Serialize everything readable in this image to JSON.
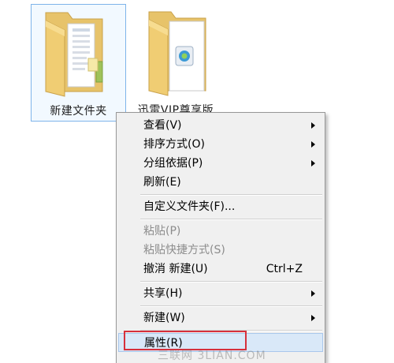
{
  "desktop": {
    "items": [
      {
        "label": "新建文件夹",
        "selected": true
      },
      {
        "label": "迅雷VIP尊享版",
        "selected": false
      }
    ]
  },
  "context_menu": {
    "items": [
      {
        "label": "查看(V)",
        "submenu": true,
        "enabled": true
      },
      {
        "label": "排序方式(O)",
        "submenu": true,
        "enabled": true
      },
      {
        "label": "分组依据(P)",
        "submenu": true,
        "enabled": true
      },
      {
        "label": "刷新(E)",
        "submenu": false,
        "enabled": true
      },
      {
        "label": "自定义文件夹(F)...",
        "submenu": false,
        "enabled": true
      },
      {
        "label": "粘贴(P)",
        "submenu": false,
        "enabled": false
      },
      {
        "label": "粘贴快捷方式(S)",
        "submenu": false,
        "enabled": false
      },
      {
        "label": "撤消 新建(U)",
        "shortcut": "Ctrl+Z",
        "submenu": false,
        "enabled": true
      },
      {
        "label": "共享(H)",
        "submenu": true,
        "enabled": true
      },
      {
        "label": "新建(W)",
        "submenu": true,
        "enabled": true
      },
      {
        "label": "属性(R)",
        "submenu": false,
        "enabled": true,
        "highlighted": true
      }
    ]
  },
  "colors": {
    "highlight_box": "#d6303c",
    "menu_background": "#f0f0f0",
    "selection_border": "#7eb4ea"
  },
  "watermark": "三联网 3LIAN.COM"
}
